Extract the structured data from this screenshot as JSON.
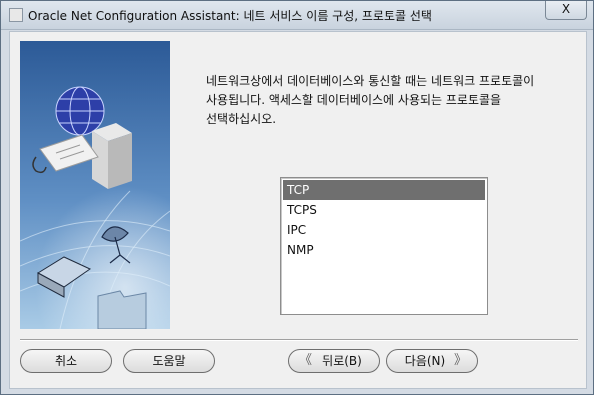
{
  "window": {
    "title": "Oracle Net Configuration Assistant: 네트 서비스 이름 구성, 프로토콜 선택",
    "close_label": "X"
  },
  "intro": {
    "line1": "네트워크상에서 데이터베이스와 통신할 때는 네트워크 프로토콜이",
    "line2": "사용됩니다. 액세스할 데이터베이스에 사용되는 프로토콜을",
    "line3": "선택하십시오."
  },
  "protocols": {
    "items": [
      "TCP",
      "TCPS",
      "IPC",
      "NMP"
    ],
    "selected": "TCP"
  },
  "buttons": {
    "cancel": "취소",
    "help": "도움말",
    "back": "뒤로(B)",
    "next": "다음(N)"
  },
  "colors": {
    "illustration_top": "#2c5a97",
    "illustration_bottom": "#a9cbe6",
    "selection": "#6f6f6f"
  }
}
